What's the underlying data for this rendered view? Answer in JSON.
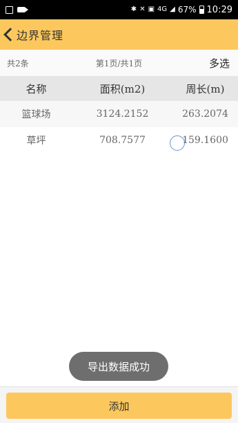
{
  "status_bar": {
    "battery": "67%",
    "time": "10:29",
    "signal_label": "4G"
  },
  "header": {
    "title": "边界管理"
  },
  "info": {
    "count": "共2条",
    "pages": "第1页/共1页",
    "multi_select": "多选"
  },
  "table": {
    "columns": [
      "名称",
      "面积(m2)",
      "周长(m)"
    ],
    "rows": [
      [
        "篮球场",
        "3124.2152",
        "263.2074"
      ],
      [
        "草坪",
        "708.7577",
        "159.1600"
      ]
    ]
  },
  "toast": "导出数据成功",
  "footer": {
    "add_label": "添加"
  },
  "colors": {
    "accent": "#fcc85e",
    "toast_bg": "#6e6e6e"
  }
}
